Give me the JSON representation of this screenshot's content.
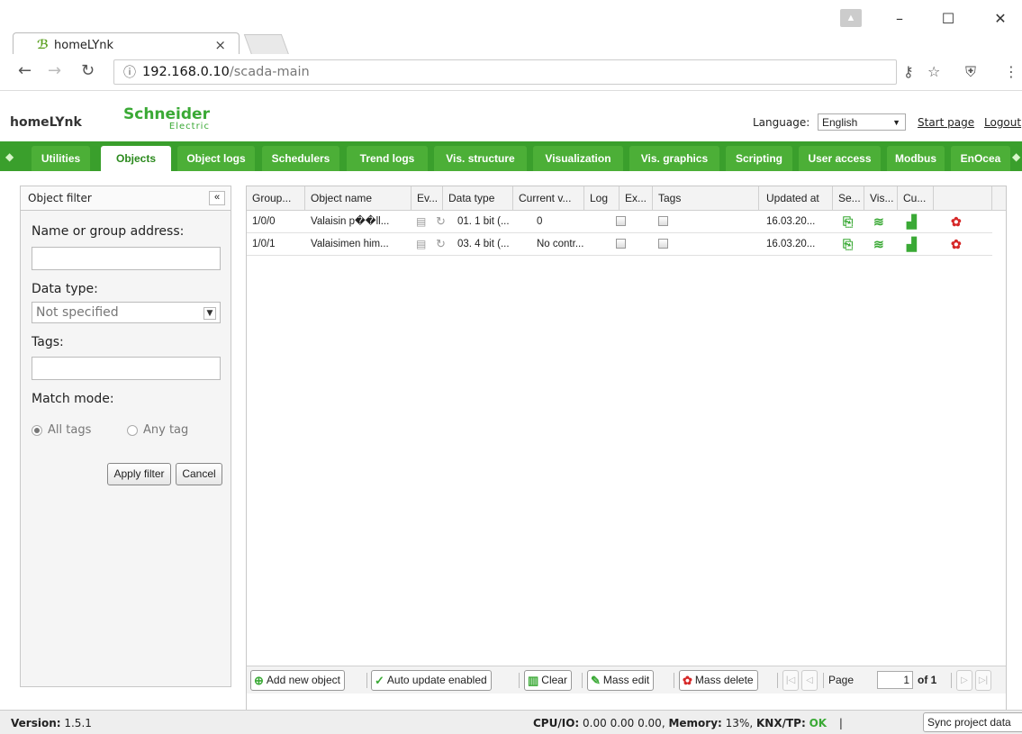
{
  "browser": {
    "tab_title": "homeLYnk",
    "tab_close": "×",
    "url_host": "192.168.0.10",
    "url_path": "/scada-main",
    "info_icon": "ⓘ"
  },
  "header": {
    "brand": "homeLYnk",
    "logo_text": "Schneider",
    "logo_sub": "Electric",
    "language_label": "Language:",
    "language_value": "English",
    "start_page": "Start page",
    "logout": "Logout"
  },
  "tabs": [
    {
      "label": "Utilities"
    },
    {
      "label": "Objects"
    },
    {
      "label": "Object logs"
    },
    {
      "label": "Schedulers"
    },
    {
      "label": "Trend logs"
    },
    {
      "label": "Vis. structure"
    },
    {
      "label": "Visualization"
    },
    {
      "label": "Vis. graphics"
    },
    {
      "label": "Scripting"
    },
    {
      "label": "User access"
    },
    {
      "label": "Modbus"
    },
    {
      "label": "EnOcea"
    }
  ],
  "filter": {
    "title": "Object filter",
    "collapse": "«",
    "name_label": "Name or group address:",
    "datatype_label": "Data type:",
    "datatype_value": "Not specified",
    "tags_label": "Tags:",
    "match_label": "Match mode:",
    "all_tags": "All tags",
    "any_tag": "Any tag",
    "apply": "Apply filter",
    "cancel": "Cancel"
  },
  "grid": {
    "columns": [
      "Group...",
      "Object name",
      "Ev...",
      "Data type",
      "Current v...",
      "Log",
      "Ex...",
      "Tags",
      "Updated at",
      "Se...",
      "Vis...",
      "Cu..."
    ],
    "rows": [
      {
        "group": "1/0/0",
        "name": "Valaisin p��ll...",
        "datatype": "01. 1 bit (...",
        "current": "0",
        "updated": "16.03.20..."
      },
      {
        "group": "1/0/1",
        "name": "Valaisimen him...",
        "datatype": "03. 4 bit (...",
        "current": "No contr...",
        "updated": "16.03.20..."
      }
    ]
  },
  "toolbar": {
    "add": "Add new object",
    "auto": "Auto update enabled",
    "clear": "Clear",
    "mass_edit": "Mass edit",
    "mass_delete": "Mass delete",
    "page_label": "Page",
    "page_value": "1",
    "page_of": "of 1"
  },
  "status": {
    "version_label": "Version:",
    "version_value": "1.5.1",
    "cpu_label": "CPU/IO:",
    "cpu_value": "0.00 0.00 0.00,",
    "mem_label": "Memory:",
    "mem_value": "13%,",
    "knx_label": "KNX/TP:",
    "knx_value": "OK",
    "sync": "Sync project data"
  },
  "colors": {
    "accent": "#3a9f2c",
    "tab": "#4caf37",
    "ok": "#3aa935",
    "delete": "#d62828"
  }
}
